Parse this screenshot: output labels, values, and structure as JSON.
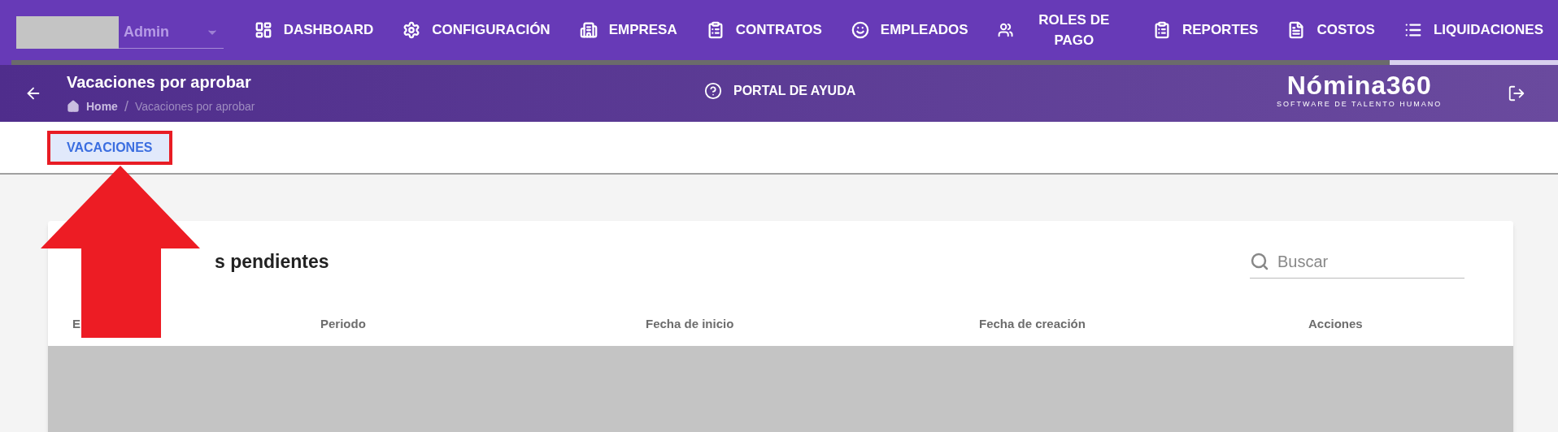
{
  "user_select": {
    "value": "Admin"
  },
  "nav": [
    {
      "label": "DASHBOARD",
      "selected": false
    },
    {
      "label": "CONFIGURACIÓN",
      "selected": false
    },
    {
      "label": "EMPRESA",
      "selected": false
    },
    {
      "label": "CONTRATOS",
      "selected": false
    },
    {
      "label": "EMPLEADOS",
      "selected": false
    },
    {
      "label": "ROLES DE PAGO",
      "selected": false
    },
    {
      "label": "REPORTES",
      "selected": false
    },
    {
      "label": "COSTOS",
      "selected": false
    },
    {
      "label": "LIQUIDACIONES",
      "selected": true
    }
  ],
  "header": {
    "title": "Vacaciones por aprobar",
    "breadcrumb": [
      "Home",
      "Vacaciones por aprobar"
    ],
    "breadcrumb_separator": "/",
    "help_link": "PORTAL DE AYUDA",
    "logo": {
      "name": "Nómina360",
      "tagline": "SOFTWARE DE TALENTO HUMANO"
    }
  },
  "tabs": [
    {
      "label": "VACACIONES",
      "selected": true
    }
  ],
  "card": {
    "title_visible": "s pendientes",
    "search": {
      "placeholder": "Buscar"
    },
    "columns": [
      "E",
      "Periodo",
      "Fecha de inicio",
      "Fecha de creación",
      "Acciones"
    ]
  }
}
